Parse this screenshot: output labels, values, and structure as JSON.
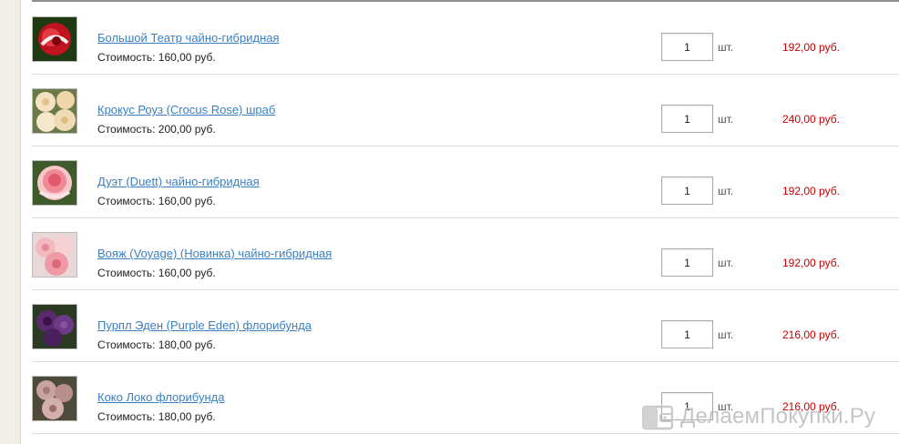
{
  "cart": {
    "unit_label": "шт.",
    "cost_label": "Стоимость:",
    "items": [
      {
        "name": "Большой Театр чайно-гибридная",
        "cost": "160,00 руб.",
        "qty": "1",
        "total": "192,00 руб."
      },
      {
        "name": "Крокус Роуз (Crocus Rose) шраб",
        "cost": "200,00 руб.",
        "qty": "1",
        "total": "240,00 руб."
      },
      {
        "name": "Дуэт (Duett) чайно-гибридная",
        "cost": "160,00 руб.",
        "qty": "1",
        "total": "192,00 руб."
      },
      {
        "name": "Вояж (Voyage) (Новинка) чайно-гибридная",
        "cost": "160,00 руб.",
        "qty": "1",
        "total": "192,00 руб."
      },
      {
        "name": "Пурпл Эден (Purple Eden) флорибунда",
        "cost": "180,00 руб.",
        "qty": "1",
        "total": "216,00 руб."
      },
      {
        "name": "Коко Локо флорибунда",
        "cost": "180,00 руб.",
        "qty": "1",
        "total": "216,00 руб."
      }
    ]
  },
  "watermark": {
    "text": "ДелаемПокупки.Ру",
    "icon": "wallet-icon"
  },
  "colors": {
    "link": "#3a7fc1",
    "price": "#c40000"
  }
}
